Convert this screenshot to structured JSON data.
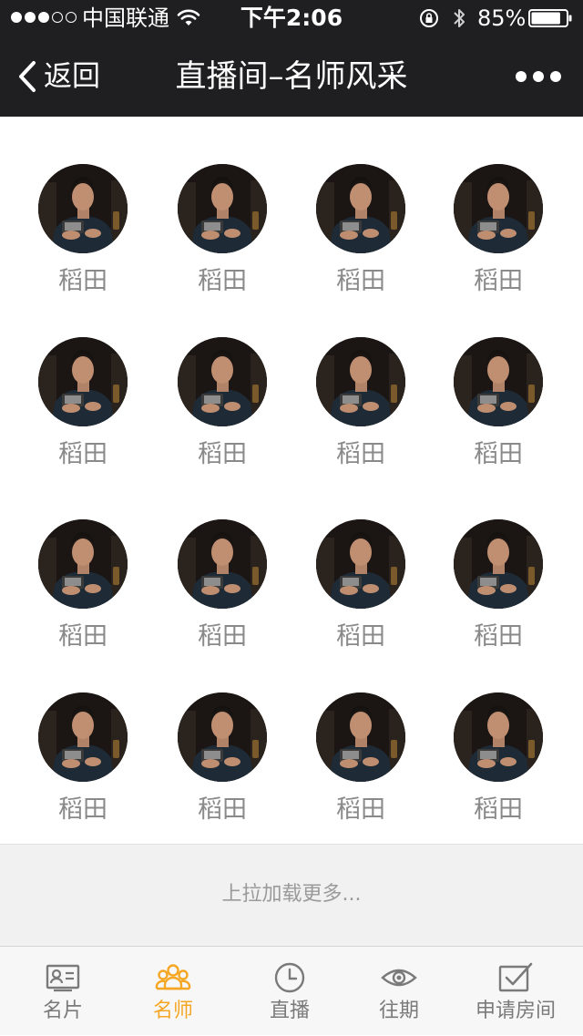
{
  "status_bar": {
    "carrier": "中国联通",
    "time": "下午2:06",
    "battery_percent": "85%",
    "battery_level": 0.85,
    "signal_bars": 3,
    "signal_total": 5
  },
  "nav": {
    "back_label": "返回",
    "title": "直播间–名师风采",
    "more_icon": "ellipsis-icon"
  },
  "teachers": [
    {
      "name": "稻田"
    },
    {
      "name": "稻田"
    },
    {
      "name": "稻田"
    },
    {
      "name": "稻田"
    },
    {
      "name": "稻田"
    },
    {
      "name": "稻田"
    },
    {
      "name": "稻田"
    },
    {
      "name": "稻田"
    },
    {
      "name": "稻田"
    },
    {
      "name": "稻田"
    },
    {
      "name": "稻田"
    },
    {
      "name": "稻田"
    },
    {
      "name": "稻田"
    },
    {
      "name": "稻田"
    },
    {
      "name": "稻田"
    },
    {
      "name": "稻田"
    }
  ],
  "load_more": "上拉加载更多...",
  "tabs": [
    {
      "label": "名片",
      "icon": "id-card-icon",
      "active": false
    },
    {
      "label": "名师",
      "icon": "group-icon",
      "active": true
    },
    {
      "label": "直播",
      "icon": "clock-icon",
      "active": false
    },
    {
      "label": "往期",
      "icon": "eye-icon",
      "active": false
    },
    {
      "label": "申请房间",
      "icon": "checkbox-edit-icon",
      "active": false
    }
  ],
  "colors": {
    "header_bg": "#1f1f21",
    "accent": "#f5a623",
    "tab_inactive": "#7a7a7a",
    "name_text": "#8a8a8a"
  }
}
